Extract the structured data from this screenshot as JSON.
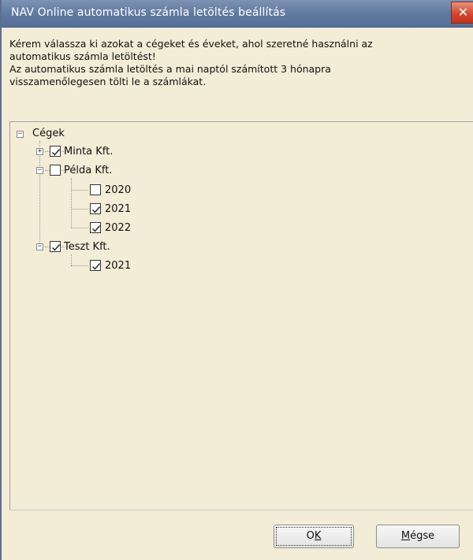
{
  "window": {
    "title": "NAV Online automatikus számla letöltés beállítás",
    "close_glyph": "✕"
  },
  "instructions": [
    "Kérem válassza ki azokat a cégeket és éveket, ahol szeretné használni az",
    "automatikus számla letöltést!",
    "Az automatikus számla letöltés a mai naptól számított 3 hónapra",
    "visszamenőlegesen tölti le a számlákat."
  ],
  "tree": {
    "root": {
      "label": "Cégek",
      "expanded": true
    },
    "companies": [
      {
        "label": "Minta Kft.",
        "checked": true,
        "expanded": false,
        "years": []
      },
      {
        "label": "Példa Kft.",
        "checked": false,
        "expanded": true,
        "years": [
          {
            "label": "2020",
            "checked": false
          },
          {
            "label": "2021",
            "checked": true
          },
          {
            "label": "2022",
            "checked": true
          }
        ]
      },
      {
        "label": "Teszt Kft.",
        "checked": true,
        "expanded": true,
        "years": [
          {
            "label": "2021",
            "checked": true
          }
        ]
      }
    ]
  },
  "buttons": {
    "ok_label": "OK",
    "ok_mnemonic": "K",
    "cancel_label": "Mégse",
    "cancel_mnemonic": "M"
  },
  "icons": {
    "expand": "plus-box-icon",
    "collapse": "minus-box-icon",
    "check": "checkmark-icon"
  },
  "colors": {
    "titlebar": "#5f789e",
    "background": "#f3ecd6",
    "close_button": "#d0442a"
  }
}
